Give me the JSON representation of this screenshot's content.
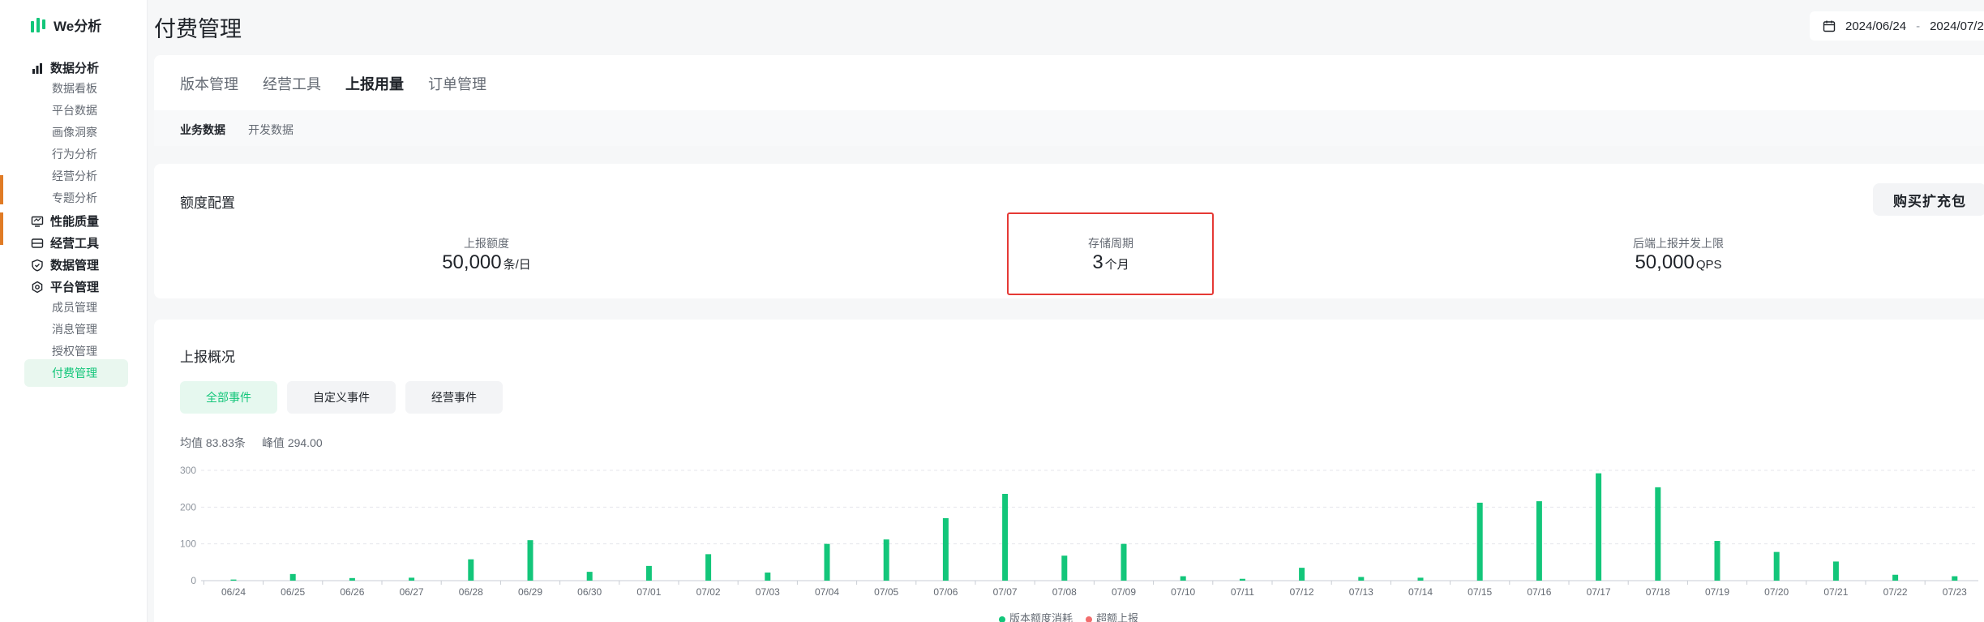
{
  "app": {
    "name": "We分析"
  },
  "sidebar": {
    "items": [
      {
        "label": "数据分析",
        "type": "group",
        "icon": "bar-chart-icon"
      },
      {
        "label": "数据看板",
        "type": "sub"
      },
      {
        "label": "平台数据",
        "type": "sub"
      },
      {
        "label": "画像洞察",
        "type": "sub"
      },
      {
        "label": "行为分析",
        "type": "sub"
      },
      {
        "label": "经营分析",
        "type": "sub"
      },
      {
        "label": "专题分析",
        "type": "sub"
      },
      {
        "label": "性能质量",
        "type": "group",
        "icon": "monitor-icon"
      },
      {
        "label": "经营工具",
        "type": "group",
        "icon": "wallet-icon"
      },
      {
        "label": "数据管理",
        "type": "group",
        "icon": "shield-icon"
      },
      {
        "label": "平台管理",
        "type": "group",
        "icon": "settings-icon"
      },
      {
        "label": "成员管理",
        "type": "sub"
      },
      {
        "label": "消息管理",
        "type": "sub"
      },
      {
        "label": "授权管理",
        "type": "sub"
      },
      {
        "label": "付费管理",
        "type": "sub",
        "active": true
      }
    ]
  },
  "header": {
    "title": "付费管理",
    "date_start": "2024/06/24",
    "date_sep": "-",
    "date_end": "2024/07/2"
  },
  "tabs": [
    "版本管理",
    "经营工具",
    "上报用量",
    "订单管理"
  ],
  "active_tab": 2,
  "subtabs": [
    "业务数据",
    "开发数据"
  ],
  "active_subtab": 0,
  "quota": {
    "title": "额度配置",
    "buy_label": "购买扩充包",
    "metrics": [
      {
        "label": "上报额度",
        "value": "50,000",
        "unit": "条/日"
      },
      {
        "label": "存储周期",
        "value": "3",
        "unit": "个月"
      },
      {
        "label": "后端上报并发上限",
        "value": "50,000",
        "unit": "QPS"
      }
    ]
  },
  "overview": {
    "title": "上报概况",
    "filters": [
      "全部事件",
      "自定义事件",
      "经营事件"
    ],
    "active_filter": 0,
    "avg_label": "均值 83.83条",
    "peak_label": "峰值 294.00"
  },
  "colors": {
    "accent": "#13c67a",
    "highlight": "#e53935",
    "series2": "#f26d6d"
  },
  "chart_data": {
    "type": "bar",
    "categories": [
      "06/24",
      "06/25",
      "06/26",
      "06/27",
      "06/28",
      "06/29",
      "06/30",
      "07/01",
      "07/02",
      "07/03",
      "07/04",
      "07/05",
      "07/06",
      "07/07",
      "07/08",
      "07/09",
      "07/10",
      "07/11",
      "07/12",
      "07/13",
      "07/14",
      "07/15",
      "07/16",
      "07/17",
      "07/18",
      "07/19",
      "07/20",
      "07/21",
      "07/22",
      "07/23"
    ],
    "series": [
      {
        "name": "版本额度消耗",
        "color": "#13c67a",
        "values": [
          3,
          18,
          7,
          8,
          58,
          110,
          24,
          40,
          72,
          22,
          100,
          112,
          170,
          236,
          68,
          100,
          12,
          5,
          35,
          10,
          8,
          212,
          216,
          292,
          254,
          108,
          78,
          52,
          16,
          12
        ]
      },
      {
        "name": "超额上报",
        "color": "#f26d6d",
        "values": [
          0,
          0,
          0,
          0,
          0,
          0,
          0,
          0,
          0,
          0,
          0,
          0,
          0,
          0,
          0,
          0,
          0,
          0,
          0,
          0,
          0,
          0,
          0,
          0,
          0,
          0,
          0,
          0,
          0,
          0
        ]
      }
    ],
    "yticks": [
      "0",
      "100",
      "200",
      "300"
    ],
    "ylim": [
      0,
      300
    ],
    "grid": true,
    "legend": "bottom"
  }
}
